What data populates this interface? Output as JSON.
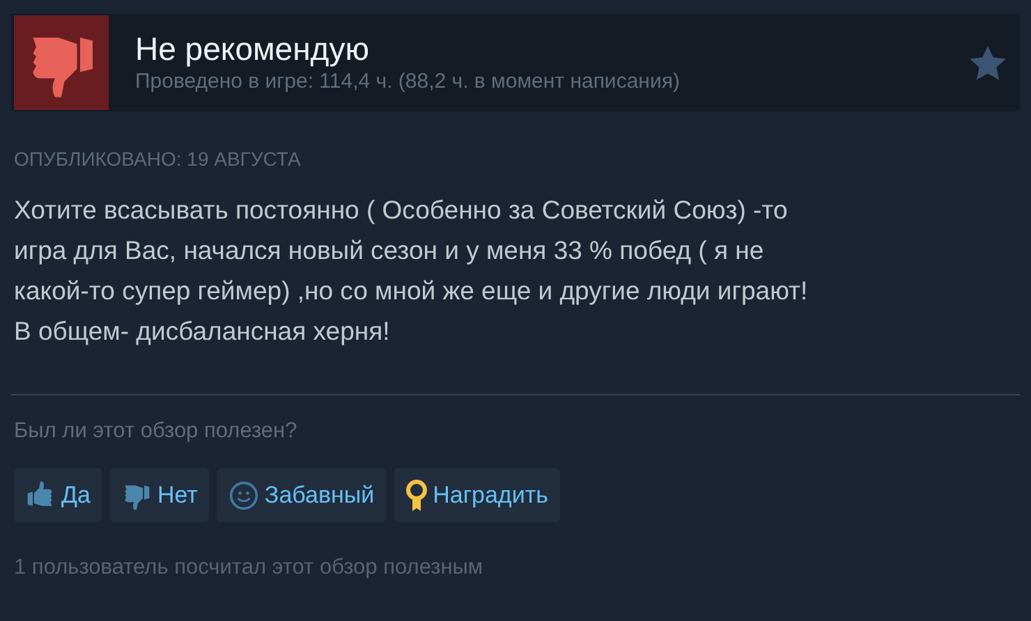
{
  "header": {
    "verdict": "Не рекомендую",
    "kind": "negative",
    "playtime": "Проведено в игре: 114,4 ч. (88,2 ч. в момент написания)"
  },
  "posted": "ОПУБЛИКОВАНО: 19 АВГУСТА",
  "review_lines": [
    "Хотите всасывать постоянно ( Особенно за Советский Союз) -то",
    "игра для Вас, начался новый сезон и у меня 33 % побед ( я не",
    "какой-то супер геймер) ,но со мной же еще и другие люди играют!",
    "В общем- дисбалансная херня!"
  ],
  "question": "Был ли этот обзор полезен?",
  "buttons": [
    {
      "label": "Да",
      "kind": "thumbs-up"
    },
    {
      "label": "Нет",
      "kind": "thumbs-down"
    },
    {
      "label": "Забавный",
      "kind": "smile"
    },
    {
      "label": "Наградить",
      "kind": "award"
    }
  ],
  "helpful_count": "1 пользователь посчитал этот обзор полезным"
}
